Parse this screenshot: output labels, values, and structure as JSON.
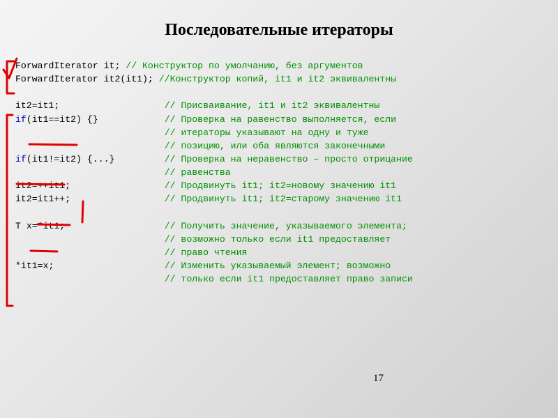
{
  "title": "Последовательные итераторы",
  "page_number": "17",
  "code": {
    "l1a": "ForwardIterator it; ",
    "l1c": "// Конструктор по умолчанию, без аргументов",
    "l2a": "ForwardIterator it2(it1); ",
    "l2c": "//Конструктор копий, it1 и it2 эквивалентны",
    "l3a": "it2=it1;                   ",
    "l3c": "// Присваивание, it1 и it2 эквивалентны",
    "l4k": "if",
    "l4a": "(it1==it2) {}            ",
    "l4c": "// Проверка на равенство выполняется, если",
    "l5s": "                           ",
    "l5c": "// итераторы указывают на одну и туже",
    "l6s": "                           ",
    "l6c": "// позицию, или оба являются законечными",
    "l7k": "if",
    "l7a": "(it1!=it2) {...}         ",
    "l7c": "// Проверка на неравенство – просто отрицание",
    "l8s": "                           ",
    "l8c": "// равенства",
    "l9a": "it2=++it1;                 ",
    "l9c": "// Продвинуть it1; it2=новому значению it1",
    "l10a": "it2=it1++;                 ",
    "l10c": "// Продвинуть it1; it2=старому значению it1",
    "l11a": "T x=*it1;                  ",
    "l11c": "// Получить значение, указываемого элемента;",
    "l12s": "                           ",
    "l12c": "// возможно только если it1 предоставляет",
    "l13s": "                           ",
    "l13c": "// право чтения",
    "l14a": "*it1=x;                    ",
    "l14c": "// Изменить указываемый элемент; возможно",
    "l15s": "                           ",
    "l15c": "// только если it1 предоставляет право записи"
  }
}
